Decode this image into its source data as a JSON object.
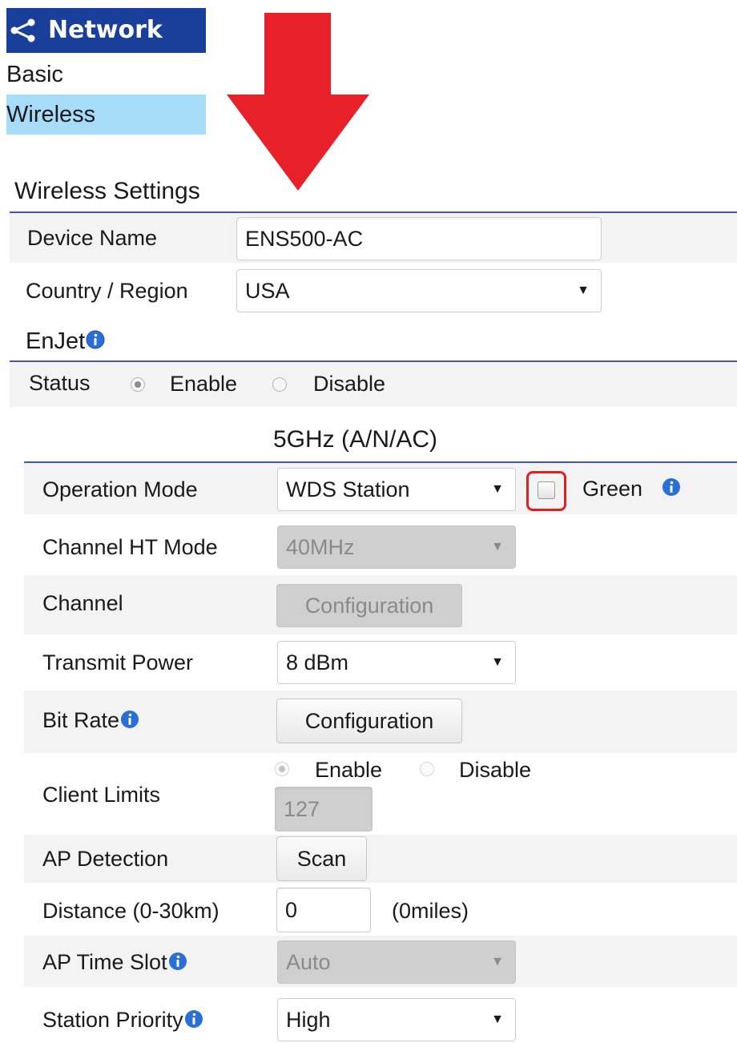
{
  "nav": {
    "header": "Network",
    "items": [
      "Basic",
      "Wireless"
    ],
    "active": "Wireless"
  },
  "wireless_settings": {
    "title": "Wireless Settings",
    "device_name": {
      "label": "Device Name",
      "value": "ENS500-AC"
    },
    "country": {
      "label": "Country / Region",
      "value": "USA"
    }
  },
  "enjet": {
    "title": "EnJet",
    "status": {
      "label": "Status",
      "enable": "Enable",
      "disable": "Disable",
      "selected": "Enable"
    }
  },
  "band": {
    "title": "5GHz (A/N/AC)",
    "operation_mode": {
      "label": "Operation Mode",
      "value": "WDS Station",
      "green_label": "Green",
      "green_checked": false
    },
    "channel_ht_mode": {
      "label": "Channel HT Mode",
      "value": "40MHz"
    },
    "channel": {
      "label": "Channel",
      "button": "Configuration"
    },
    "transmit_power": {
      "label": "Transmit Power",
      "value": "8 dBm"
    },
    "bit_rate": {
      "label": "Bit Rate",
      "button": "Configuration"
    },
    "client_limits": {
      "label": "Client Limits",
      "enable": "Enable",
      "disable": "Disable",
      "selected": "Enable",
      "value": "127"
    },
    "ap_detection": {
      "label": "AP Detection",
      "button": "Scan"
    },
    "distance": {
      "label": "Distance (0-30km)",
      "value": "0",
      "miles": "(0miles)"
    },
    "ap_time_slot": {
      "label": "AP Time Slot",
      "value": "Auto"
    },
    "station_priority": {
      "label": "Station Priority",
      "value": "High"
    }
  },
  "colors": {
    "nav_header_bg": "#1a3f9b",
    "nav_active_bg": "#a7dcf8",
    "arrow": "#e8202a",
    "highlight_box": "#e02020",
    "section_line": "#3f5aa0",
    "info_icon": "#2a6fd6"
  },
  "icons": [
    "share-icon",
    "info-icon",
    "caret-down-icon",
    "red-arrow-annotation"
  ]
}
